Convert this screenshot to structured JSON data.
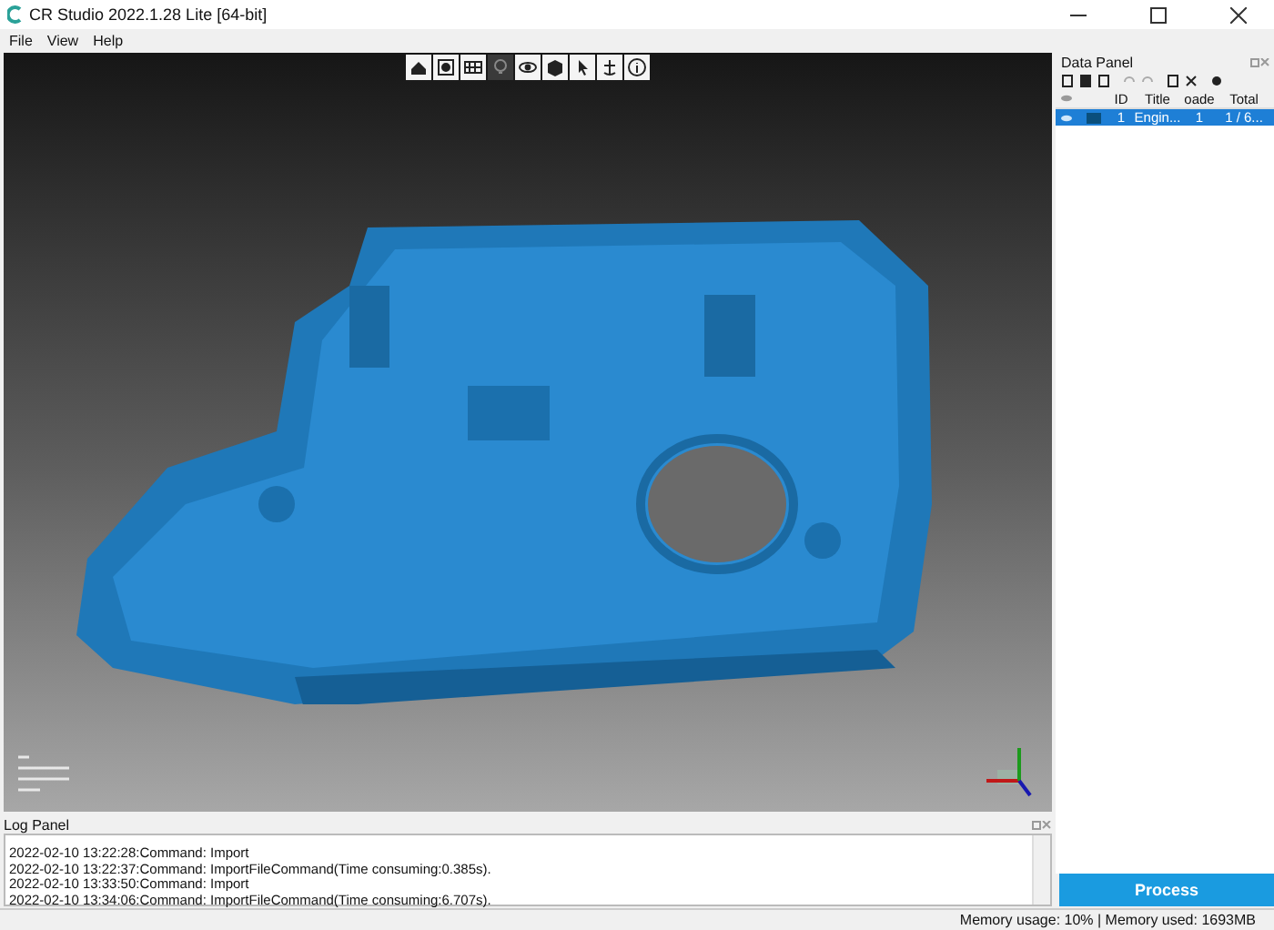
{
  "window": {
    "title": "CR Studio 2022.1.28 Lite [64-bit]"
  },
  "menu": [
    "File",
    "View",
    "Help"
  ],
  "view_tools": [
    {
      "selected": false
    },
    {
      "selected": false
    },
    {
      "selected": false
    },
    {
      "selected": true
    },
    {
      "selected": false
    },
    {
      "selected": false
    },
    {
      "selected": false
    },
    {
      "selected": false
    },
    {
      "selected": false
    }
  ],
  "data_panel": {
    "title": "Data Panel",
    "columns": [
      "ID",
      "Title",
      "oade",
      "Total"
    ],
    "rows": [
      {
        "selected": true,
        "color": "#0a4f7c",
        "id": "1",
        "title": "Engin...",
        "loaded": "1",
        "total": "1 / 6..."
      }
    ],
    "process_button": "Process"
  },
  "log_panel": {
    "title": "Log Panel",
    "lines": [
      "2022-02-10 13:22:28:Command: Import",
      "2022-02-10 13:22:37:Command: ImportFileCommand(Time consuming:0.385s).",
      "2022-02-10 13:33:50:Command: Import",
      "2022-02-10 13:34:06:Command: ImportFileCommand(Time consuming:6.707s)."
    ]
  },
  "status_bar": "Memory usage: 10% | Memory used: 1693MB"
}
